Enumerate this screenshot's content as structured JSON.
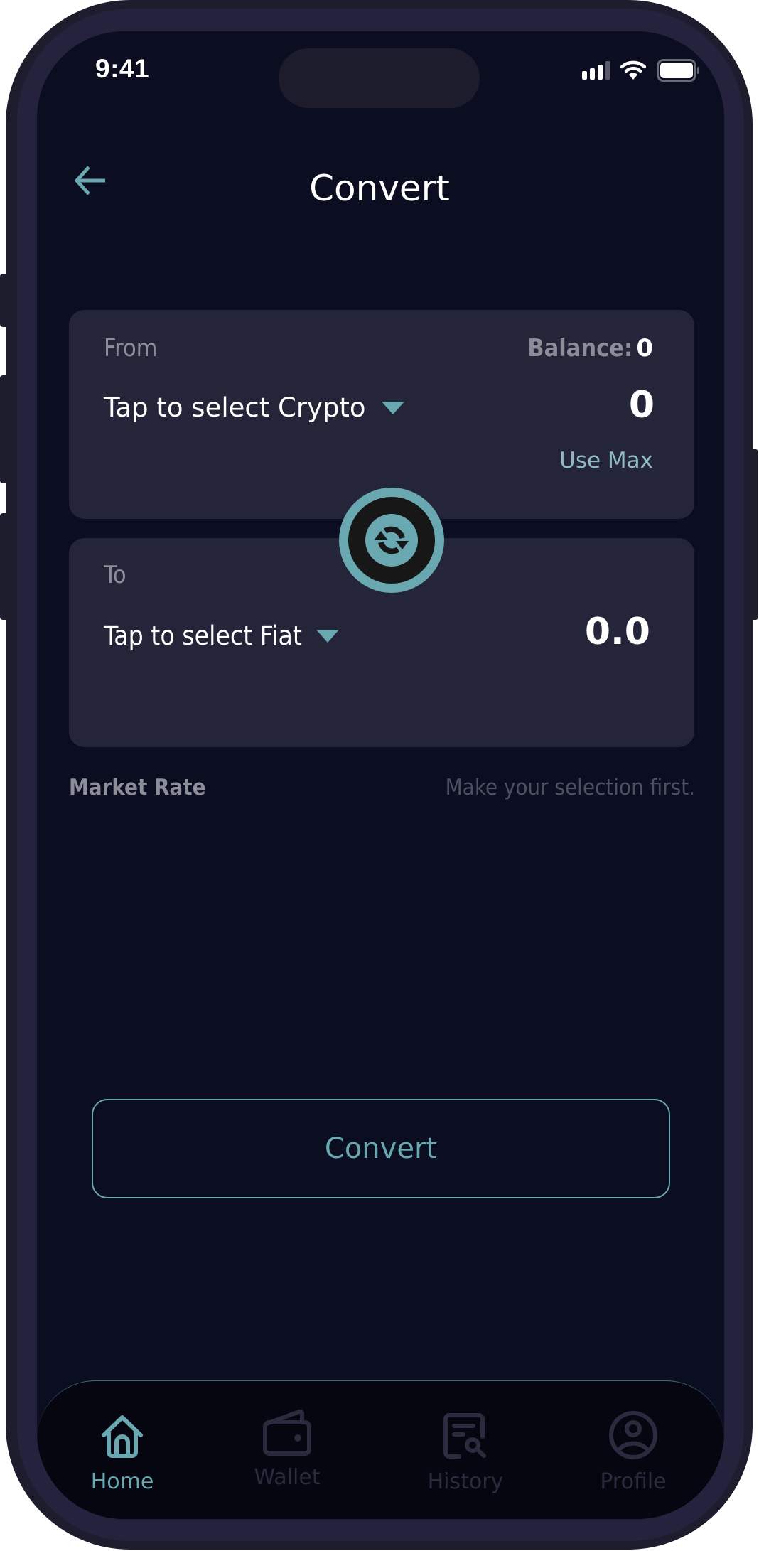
{
  "status_bar": {
    "time": "9:41",
    "icons": [
      "cellular-signal-icon",
      "wifi-icon",
      "battery-icon"
    ]
  },
  "header": {
    "back_icon": "arrow-left-icon",
    "title": "Convert"
  },
  "from_card": {
    "label": "From",
    "balance_label": "Balance:",
    "balance_value": "0",
    "select_placeholder": "Tap to select Crypto",
    "amount": "0",
    "use_max_label": "Use Max"
  },
  "swap_button": {
    "icon": "swap-arrows-icon"
  },
  "to_card": {
    "label": "To",
    "select_placeholder": "Tap to select Fiat",
    "amount": "0.0"
  },
  "market_rate": {
    "label": "Market Rate",
    "value": "Make your selection first."
  },
  "convert_button": {
    "label": "Convert"
  },
  "bottom_nav": {
    "items": [
      {
        "label": "Home",
        "icon": "home-icon",
        "active": true
      },
      {
        "label": "Wallet",
        "icon": "wallet-icon",
        "active": false
      },
      {
        "label": "History",
        "icon": "history-search-icon",
        "active": false
      },
      {
        "label": "Profile",
        "icon": "profile-icon",
        "active": false
      }
    ]
  },
  "colors": {
    "accent": "#6aa8b1",
    "background": "#0b0d20",
    "card": "#252539",
    "muted_text": "#8d8d9a",
    "inactive_nav": "#2b2a3e"
  }
}
